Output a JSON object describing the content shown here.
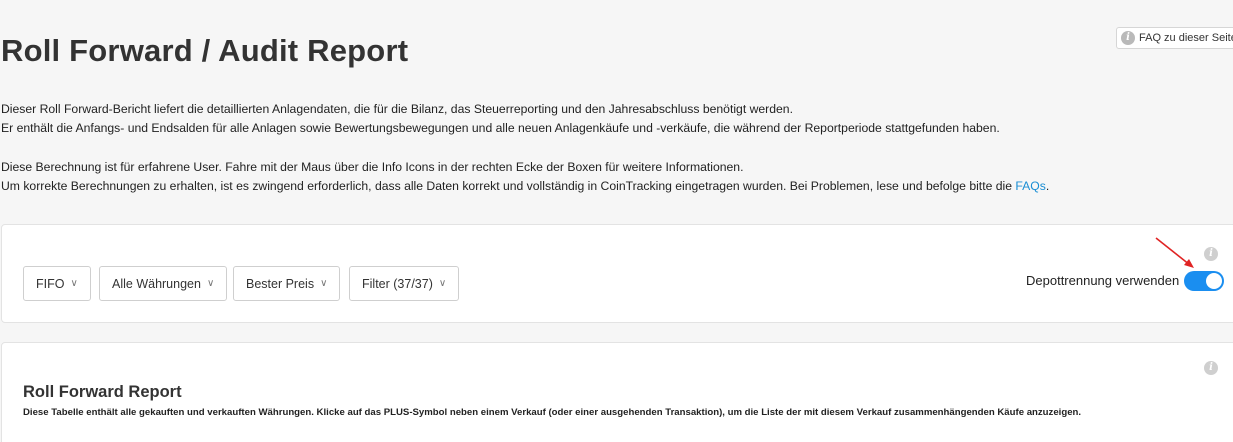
{
  "faq_button": {
    "label": "FAQ zu dieser Seite"
  },
  "page_title": "Roll Forward / Audit Report",
  "intro": {
    "line1": "Dieser Roll Forward-Bericht liefert die detaillierten Anlagendaten, die für die Bilanz, das Steuerreporting und den Jahresabschluss benötigt werden.",
    "line2": "Er enthält die Anfangs- und Endsalden für alle Anlagen sowie Bewertungsbewegungen und alle neuen Anlagenkäufe und -verkäufe, die während der Reportperiode stattgefunden haben.",
    "line3": "Diese Berechnung ist für erfahrene User. Fahre mit der Maus über die Info Icons in der rechten Ecke der Boxen für weitere Informationen.",
    "line4": "Um korrekte Berechnungen zu erhalten, ist es zwingend erforderlich, dass alle Daten korrekt und vollständig in CoinTracking eingetragen wurden. Bei Problemen, lese und befolge bitte die ",
    "faq_link": "FAQs",
    "line4_end": "."
  },
  "settings": {
    "method": "FIFO",
    "currencies": "Alle Währungen",
    "price": "Bester Preis",
    "filter": "Filter (37/37)",
    "toggle_label": "Depottrennung verwenden",
    "toggle_on": true
  },
  "report": {
    "title": "Roll Forward Report",
    "description": "Diese Tabelle enthält alle gekauften und verkauften Währungen. Klicke auf das PLUS-Symbol neben einem Verkauf (oder einer ausgehenden Transaktion), um die Liste der mit diesem Verkauf zusammenhängenden Käufe anzuzeigen."
  },
  "colors": {
    "accent": "#1a8ef0",
    "link": "#1a8ed4",
    "annotation_arrow": "#e02424"
  },
  "icons": [
    "info-icon",
    "chevron-down-icon",
    "red-arrow"
  ]
}
